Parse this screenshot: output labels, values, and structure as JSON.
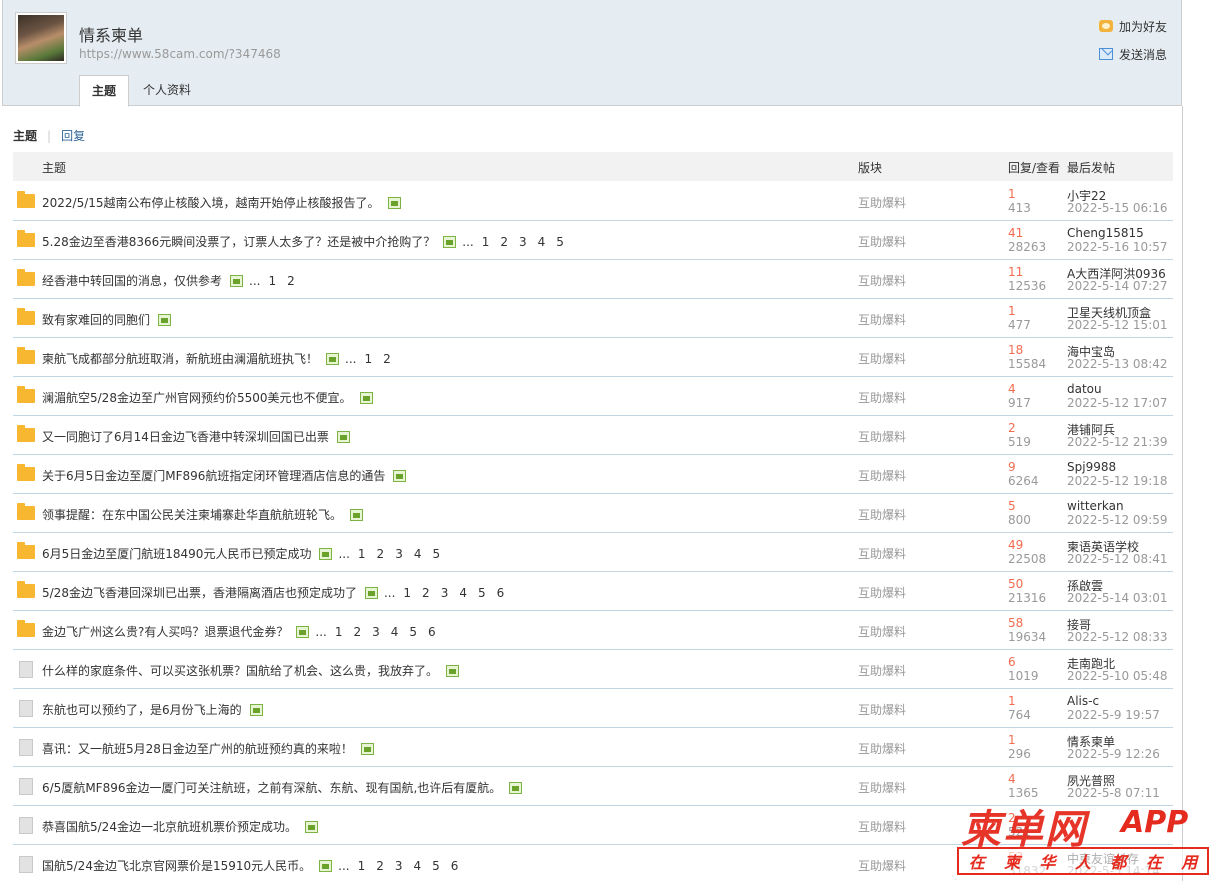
{
  "profile": {
    "username": "情系柬单",
    "url": "https://www.58cam.com/?347468",
    "add_friend": "加为好友",
    "send_message": "发送消息"
  },
  "tabs": [
    {
      "label": "主题",
      "active": true
    },
    {
      "label": "个人资料",
      "active": false
    }
  ],
  "subnav": {
    "topics": "主题",
    "sep": "|",
    "replies": "回复"
  },
  "table_header": {
    "topic": "主题",
    "forum": "版块",
    "reply_view": "回复/查看",
    "last_post": "最后发帖"
  },
  "rows": [
    {
      "title": "2022/5/15越南公布停止核酸入境，越南开始停止核酸报告了。",
      "pages": [],
      "forum": "互助爆料",
      "replies": "1",
      "views": "413",
      "last_user": "小宇22",
      "last_time": "2022-5-15 06:16",
      "folder": "new"
    },
    {
      "title": "5.28金边至香港8366元瞬间没票了，订票人太多了？还是被中介抢购了？",
      "pages": [
        "1",
        "2",
        "3",
        "4",
        "5"
      ],
      "forum": "互助爆料",
      "replies": "41",
      "views": "28263",
      "last_user": "Cheng15815",
      "last_time": "2022-5-16 10:57",
      "folder": "new"
    },
    {
      "title": "经香港中转回国的消息，仅供参考",
      "pages": [
        "1",
        "2"
      ],
      "forum": "互助爆料",
      "replies": "11",
      "views": "12536",
      "last_user": "A大西洋阿洪0936",
      "last_time": "2022-5-14 07:27",
      "folder": "new"
    },
    {
      "title": "致有家难回的同胞们",
      "pages": [],
      "forum": "互助爆料",
      "replies": "1",
      "views": "477",
      "last_user": "卫星天线机顶盒",
      "last_time": "2022-5-12 15:01",
      "folder": "new"
    },
    {
      "title": "柬航飞成都部分航班取消，新航班由澜湄航班执飞！",
      "pages": [
        "1",
        "2"
      ],
      "forum": "互助爆料",
      "replies": "18",
      "views": "15584",
      "last_user": "海中宝岛",
      "last_time": "2022-5-13 08:42",
      "folder": "new"
    },
    {
      "title": "澜湄航空5/28金边至广州官网预约价5500美元也不便宜。",
      "pages": [],
      "forum": "互助爆料",
      "replies": "4",
      "views": "917",
      "last_user": "datou",
      "last_time": "2022-5-12 17:07",
      "folder": "new"
    },
    {
      "title": "又一同胞订了6月14日金边飞香港中转深圳回国已出票",
      "pages": [],
      "forum": "互助爆料",
      "replies": "2",
      "views": "519",
      "last_user": "港铺阿兵",
      "last_time": "2022-5-12 21:39",
      "folder": "new"
    },
    {
      "title": "关于6月5日金边至厦门MF896航班指定闭环管理酒店信息的通告",
      "pages": [],
      "forum": "互助爆料",
      "replies": "9",
      "views": "6264",
      "last_user": "Spj9988",
      "last_time": "2022-5-12 19:18",
      "folder": "new"
    },
    {
      "title": "领事提醒：在东中国公民关注柬埔寨赴华直航航班轮飞。",
      "pages": [],
      "forum": "互助爆料",
      "replies": "5",
      "views": "800",
      "last_user": "witterkan",
      "last_time": "2022-5-12 09:59",
      "folder": "new"
    },
    {
      "title": "6月5日金边至厦门航班18490元人民币已预定成功",
      "pages": [
        "1",
        "2",
        "3",
        "4",
        "5"
      ],
      "forum": "互助爆料",
      "replies": "49",
      "views": "22508",
      "last_user": "柬语英语学校",
      "last_time": "2022-5-12 08:41",
      "folder": "new"
    },
    {
      "title": "5/28金边飞香港回深圳已出票，香港隔离酒店也预定成功了",
      "pages": [
        "1",
        "2",
        "3",
        "4",
        "5",
        "6"
      ],
      "forum": "互助爆料",
      "replies": "50",
      "views": "21316",
      "last_user": "孫啟雲",
      "last_time": "2022-5-14 03:01",
      "folder": "new"
    },
    {
      "title": "金边飞广州这么贵?有人买吗？退票退代金券？",
      "pages": [
        "1",
        "2",
        "3",
        "4",
        "5",
        "6"
      ],
      "forum": "互助爆料",
      "replies": "58",
      "views": "19634",
      "last_user": "接哥",
      "last_time": "2022-5-12 08:33",
      "folder": "new"
    },
    {
      "title": "什么样的家庭条件、可以买这张机票？国航给了机会、这么贵，我放弃了。",
      "pages": [],
      "forum": "互助爆料",
      "replies": "6",
      "views": "1019",
      "last_user": "走南跑北",
      "last_time": "2022-5-10 05:48",
      "folder": "old"
    },
    {
      "title": "东航也可以预约了，是6月份飞上海的",
      "pages": [],
      "forum": "互助爆料",
      "replies": "1",
      "views": "764",
      "last_user": "Alis-c",
      "last_time": "2022-5-9 19:57",
      "folder": "old"
    },
    {
      "title": "喜讯：又一航班5月28日金边至广州的航班预约真的来啦！",
      "pages": [],
      "forum": "互助爆料",
      "replies": "1",
      "views": "296",
      "last_user": "情系柬单",
      "last_time": "2022-5-9 12:26",
      "folder": "old"
    },
    {
      "title": "6/5厦航MF896金边一厦门可关注航班，之前有深航、东航、现有国航,也许后有厦航。",
      "pages": [],
      "forum": "互助爆料",
      "replies": "4",
      "views": "1365",
      "last_user": "夙光普照",
      "last_time": "2022-5-8 07:11",
      "folder": "old"
    },
    {
      "title": "恭喜国航5/24金边一北京航班机票价预定成功。",
      "pages": [],
      "forum": "互助爆料",
      "replies": "2",
      "views": "521",
      "last_user": "",
      "last_time": "",
      "folder": "old"
    },
    {
      "title": "国航5/24金边飞北京官网票价是15910元人民币。",
      "pages": [
        "1",
        "2",
        "3",
        "4",
        "5",
        "6"
      ],
      "forum": "互助爆料",
      "replies": "53",
      "views": "31832",
      "last_user": "中柬友谊长存",
      "last_time": "2022-5-5 14:14",
      "folder": "old"
    }
  ],
  "watermark": {
    "logo": "柬单网",
    "app": "APP",
    "slogan": [
      "在",
      "柬",
      "华",
      "人",
      "都",
      "在",
      "用"
    ]
  },
  "colors": {
    "header_bg": "#e5edf2",
    "reply_count": "#f26c4f",
    "row_border": "#c2d5e3",
    "watermark": "#e52a1e"
  }
}
